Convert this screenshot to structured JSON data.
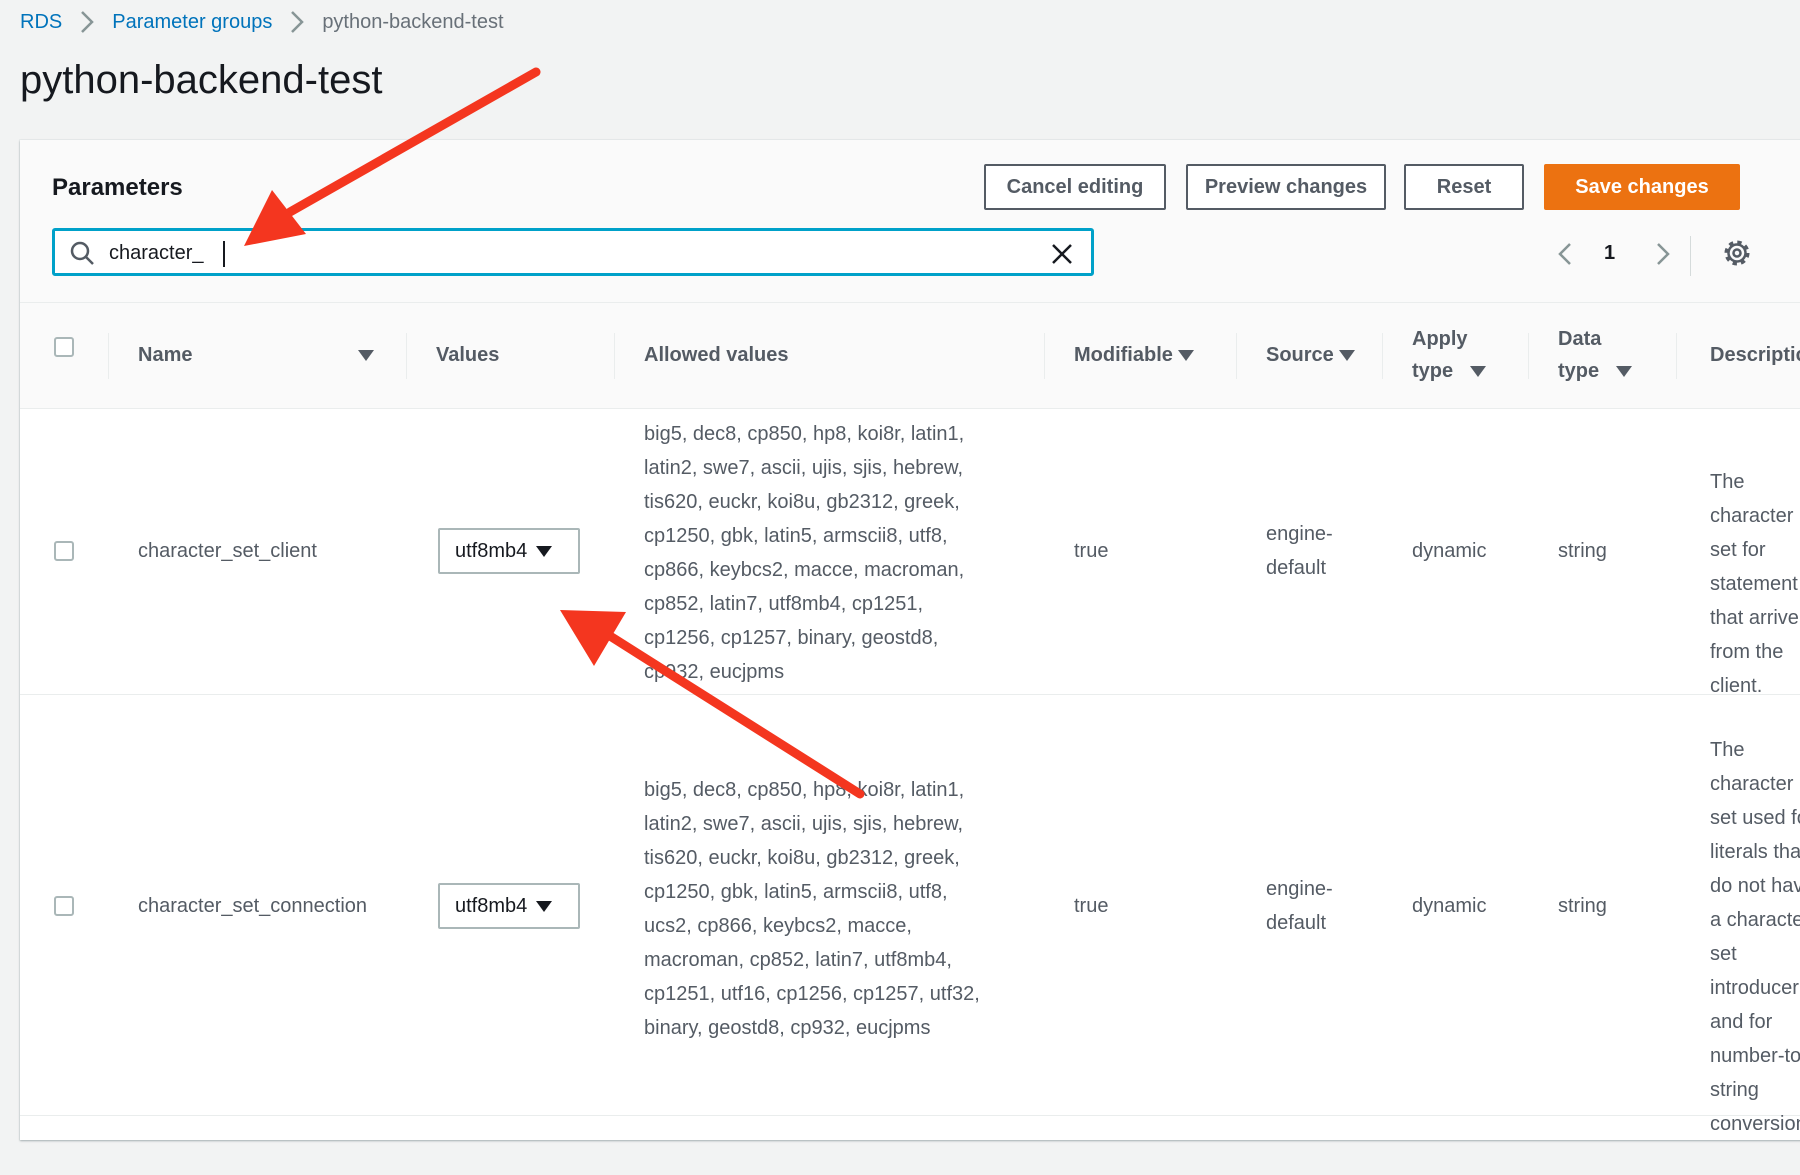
{
  "breadcrumb": {
    "items": [
      "RDS",
      "Parameter groups",
      "python-backend-test"
    ]
  },
  "page_title": "python-backend-test",
  "panel": {
    "title": "Parameters",
    "buttons": {
      "cancel": "Cancel editing",
      "preview": "Preview changes",
      "reset": "Reset",
      "save": "Save changes"
    },
    "search": {
      "value": "character_"
    },
    "pager": {
      "page": "1"
    }
  },
  "table": {
    "columns": {
      "name": "Name",
      "values": "Values",
      "allowed": "Allowed values",
      "modifiable": "Modifiable",
      "source": "Source",
      "apply_type_1": "Apply",
      "apply_type_2": "type",
      "data_type_1": "Data",
      "data_type_2": "type",
      "description": "Descriptic"
    },
    "rows": [
      {
        "name": "character_set_client",
        "value": "utf8mb4",
        "allowed": [
          "big5, dec8, cp850, hp8, koi8r, latin1,",
          "latin2, swe7, ascii, ujis, sjis, hebrew,",
          "tis620, euckr, koi8u, gb2312, greek,",
          "cp1250, gbk, latin5, armscii8, utf8,",
          "cp866, keybcs2, macce, macroman,",
          "cp852, latin7, utf8mb4, cp1251,",
          "cp1256, cp1257, binary, geostd8,",
          "cp932, eucjpms"
        ],
        "modifiable": "true",
        "source_1": "engine-",
        "source_2": "default",
        "apply_type": "dynamic",
        "data_type": "string",
        "description": [
          "The",
          "character",
          "set for",
          "statement",
          "that arrive",
          "from the",
          "client."
        ]
      },
      {
        "name": "character_set_connection",
        "value": "utf8mb4",
        "allowed": [
          "big5, dec8, cp850, hp8, koi8r, latin1,",
          "latin2, swe7, ascii, ujis, sjis, hebrew,",
          "tis620, euckr, koi8u, gb2312, greek,",
          "cp1250, gbk, latin5, armscii8, utf8,",
          "ucs2, cp866, keybcs2, macce,",
          "macroman, cp852, latin7, utf8mb4,",
          "cp1251, utf16, cp1256, cp1257, utf32,",
          "binary, geostd8, cp932, eucjpms"
        ],
        "modifiable": "true",
        "source_1": "engine-",
        "source_2": "default",
        "apply_type": "dynamic",
        "data_type": "string",
        "description": [
          "The",
          "character",
          "set used fo",
          "literals tha",
          "do not hav",
          "a characte",
          "set",
          "introducer",
          "and for",
          "number-to",
          "string",
          "conversion"
        ]
      }
    ]
  },
  "colors": {
    "accent": "#00a1c9",
    "primary": "#ec7211",
    "link": "#0073bb",
    "annotation": "#f4361f"
  },
  "icons": [
    "chevron-right-icon",
    "search-icon",
    "clear-icon",
    "chevron-left-icon",
    "gear-icon",
    "caret-down-icon",
    "annotation-arrow"
  ]
}
